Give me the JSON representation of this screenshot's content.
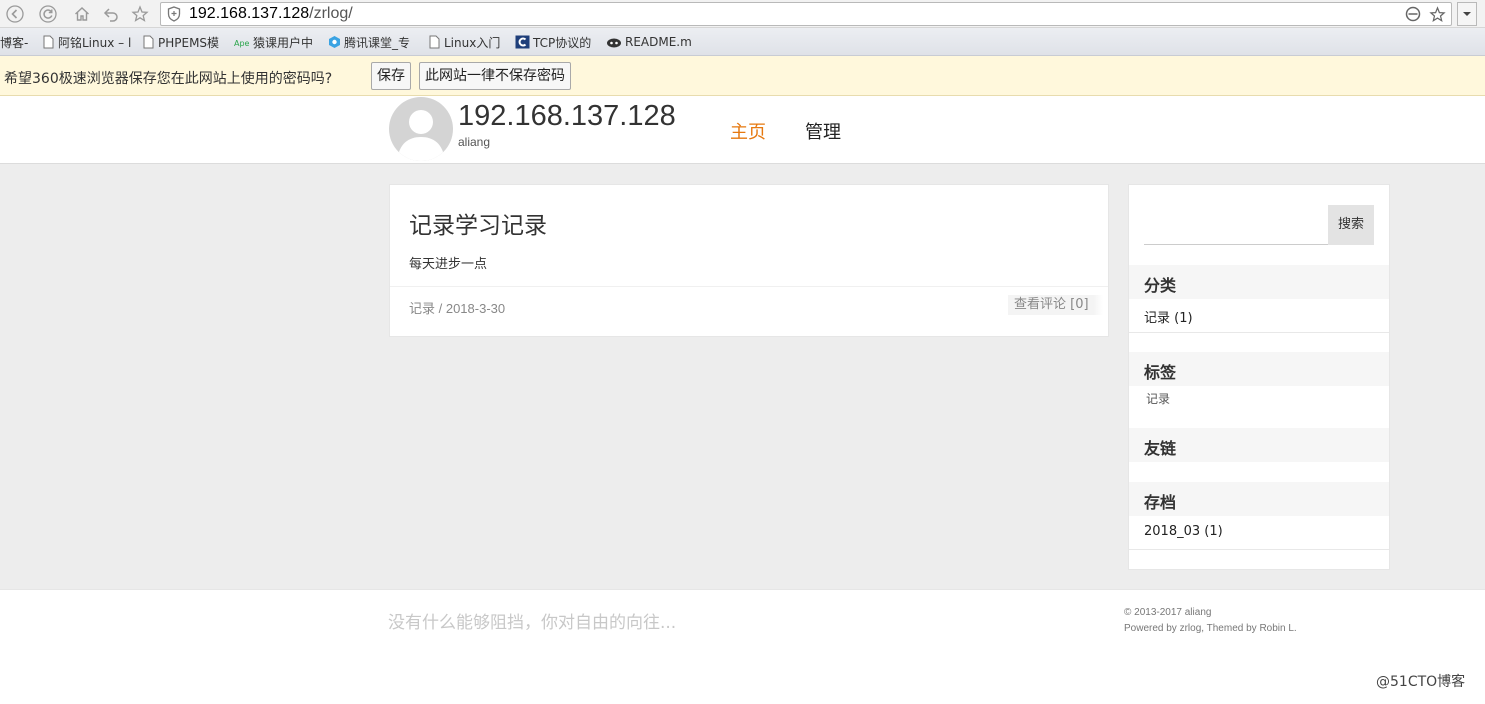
{
  "browser": {
    "url_host": "192.168.137.128",
    "url_path": "/zrlog/",
    "bookmarks": [
      {
        "label": "博客-",
        "icon": "none"
      },
      {
        "label": "阿铭Linux – l",
        "icon": "page-icon"
      },
      {
        "label": "PHPEMS模",
        "icon": "page-icon"
      },
      {
        "label": "猿课用户中",
        "icon": "ape-icon"
      },
      {
        "label": "腾讯课堂_专",
        "icon": "tencent-icon"
      },
      {
        "label": "Linux入门",
        "icon": "page-icon"
      },
      {
        "label": "TCP协议的",
        "icon": "c-icon"
      },
      {
        "label": "README.m",
        "icon": "github-icon"
      }
    ],
    "password_prompt": {
      "message": "希望360极速浏览器保存您在此网站上使用的密码吗?",
      "save": "保存",
      "never": "此网站一律不保存密码"
    }
  },
  "site": {
    "title": "192.168.137.128",
    "subtitle": "aliang",
    "nav": [
      {
        "label": "主页",
        "active": true
      },
      {
        "label": "管理",
        "active": false
      }
    ]
  },
  "post": {
    "title": "记录学习记录",
    "summary": "每天进步一点",
    "meta": "记录 / 2018-3-30",
    "comments": "查看评论 [0]"
  },
  "sidebar": {
    "search_button": "搜索",
    "categories_title": "分类",
    "categories": [
      "记录 (1)"
    ],
    "tags_title": "标签",
    "tags": [
      "记录"
    ],
    "links_title": "友链",
    "archives_title": "存档",
    "archives": [
      "2018_03 (1)"
    ]
  },
  "footer": {
    "slogan": "没有什么能够阻挡，你对自由的向往...",
    "copyright": "© 2013-2017 aliang",
    "powered": "Powered by zrlog, Themed by Robin L.",
    "watermark": "@51CTO博客"
  }
}
